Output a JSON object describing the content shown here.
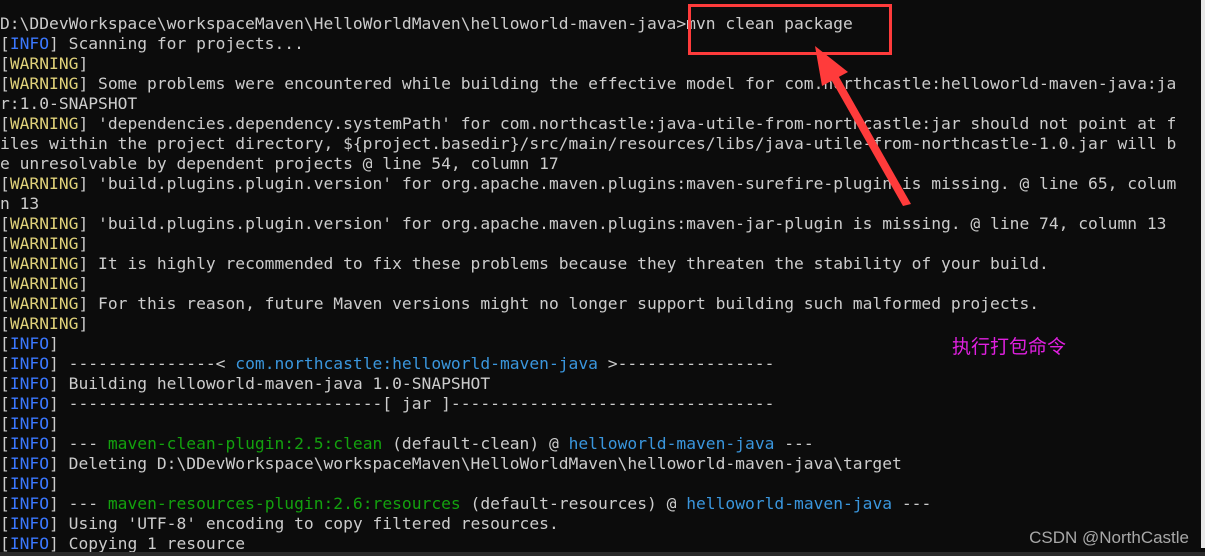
{
  "colors": {
    "default": "#cccccc",
    "info": "#3b78ff",
    "warning": "#e0d27a",
    "plugin": "#13a10e",
    "project": "#3a96dd",
    "highlight": "#ff3b3b",
    "note": "#e020e0"
  },
  "lines": [
    [
      {
        "t": "D:\\DDevWorkspace\\workspaceMaven\\HelloWorldMaven\\helloworld-maven-java>mvn clean package",
        "c": "d"
      }
    ],
    [
      {
        "t": "[",
        "c": "d"
      },
      {
        "t": "INFO",
        "c": "i"
      },
      {
        "t": "] Scanning for projects...",
        "c": "d"
      }
    ],
    [
      {
        "t": "[",
        "c": "d"
      },
      {
        "t": "WARNING",
        "c": "w"
      },
      {
        "t": "]",
        "c": "d"
      }
    ],
    [
      {
        "t": "[",
        "c": "d"
      },
      {
        "t": "WARNING",
        "c": "w"
      },
      {
        "t": "] Some problems were encountered while building the effective model for com.northcastle:helloworld-maven-java:ja",
        "c": "d"
      }
    ],
    [
      {
        "t": "r:1.0-SNAPSHOT",
        "c": "d"
      }
    ],
    [
      {
        "t": "[",
        "c": "d"
      },
      {
        "t": "WARNING",
        "c": "w"
      },
      {
        "t": "] 'dependencies.dependency.systemPath' for com.northcastle:java-utile-from-northcastle:jar should not point at f",
        "c": "d"
      }
    ],
    [
      {
        "t": "iles within the project directory, ${project.basedir}/src/main/resources/libs/java-utile-from-northcastle-1.0.jar will b",
        "c": "d"
      }
    ],
    [
      {
        "t": "e unresolvable by dependent projects @ line 54, column 17",
        "c": "d"
      }
    ],
    [
      {
        "t": "[",
        "c": "d"
      },
      {
        "t": "WARNING",
        "c": "w"
      },
      {
        "t": "] 'build.plugins.plugin.version' for org.apache.maven.plugins:maven-surefire-plugin is missing. @ line 65, colum",
        "c": "d"
      }
    ],
    [
      {
        "t": "n 13",
        "c": "d"
      }
    ],
    [
      {
        "t": "[",
        "c": "d"
      },
      {
        "t": "WARNING",
        "c": "w"
      },
      {
        "t": "] 'build.plugins.plugin.version' for org.apache.maven.plugins:maven-jar-plugin is missing. @ line 74, column 13",
        "c": "d"
      }
    ],
    [
      {
        "t": "[",
        "c": "d"
      },
      {
        "t": "WARNING",
        "c": "w"
      },
      {
        "t": "]",
        "c": "d"
      }
    ],
    [
      {
        "t": "[",
        "c": "d"
      },
      {
        "t": "WARNING",
        "c": "w"
      },
      {
        "t": "] It is highly recommended to fix these problems because they threaten the stability of your build.",
        "c": "d"
      }
    ],
    [
      {
        "t": "[",
        "c": "d"
      },
      {
        "t": "WARNING",
        "c": "w"
      },
      {
        "t": "]",
        "c": "d"
      }
    ],
    [
      {
        "t": "[",
        "c": "d"
      },
      {
        "t": "WARNING",
        "c": "w"
      },
      {
        "t": "] For this reason, future Maven versions might no longer support building such malformed projects.",
        "c": "d"
      }
    ],
    [
      {
        "t": "[",
        "c": "d"
      },
      {
        "t": "WARNING",
        "c": "w"
      },
      {
        "t": "]",
        "c": "d"
      }
    ],
    [
      {
        "t": "[",
        "c": "d"
      },
      {
        "t": "INFO",
        "c": "i"
      },
      {
        "t": "]",
        "c": "d"
      }
    ],
    [
      {
        "t": "[",
        "c": "d"
      },
      {
        "t": "INFO",
        "c": "i"
      },
      {
        "t": "] ---------------< ",
        "c": "d"
      },
      {
        "t": "com.northcastle:helloworld-maven-java",
        "c": "b"
      },
      {
        "t": " >----------------",
        "c": "d"
      }
    ],
    [
      {
        "t": "[",
        "c": "d"
      },
      {
        "t": "INFO",
        "c": "i"
      },
      {
        "t": "] Building helloworld-maven-java 1.0-SNAPSHOT",
        "c": "d"
      }
    ],
    [
      {
        "t": "[",
        "c": "d"
      },
      {
        "t": "INFO",
        "c": "i"
      },
      {
        "t": "] --------------------------------[ jar ]---------------------------------",
        "c": "d"
      }
    ],
    [
      {
        "t": "[",
        "c": "d"
      },
      {
        "t": "INFO",
        "c": "i"
      },
      {
        "t": "]",
        "c": "d"
      }
    ],
    [
      {
        "t": "[",
        "c": "d"
      },
      {
        "t": "INFO",
        "c": "i"
      },
      {
        "t": "] --- ",
        "c": "d"
      },
      {
        "t": "maven-clean-plugin:2.5:clean",
        "c": "g"
      },
      {
        "t": " (default-clean) @ ",
        "c": "d"
      },
      {
        "t": "helloworld-maven-java",
        "c": "b"
      },
      {
        "t": " ---",
        "c": "d"
      }
    ],
    [
      {
        "t": "[",
        "c": "d"
      },
      {
        "t": "INFO",
        "c": "i"
      },
      {
        "t": "] Deleting D:\\DDevWorkspace\\workspaceMaven\\HelloWorldMaven\\helloworld-maven-java\\target",
        "c": "d"
      }
    ],
    [
      {
        "t": "[",
        "c": "d"
      },
      {
        "t": "INFO",
        "c": "i"
      },
      {
        "t": "]",
        "c": "d"
      }
    ],
    [
      {
        "t": "[",
        "c": "d"
      },
      {
        "t": "INFO",
        "c": "i"
      },
      {
        "t": "] --- ",
        "c": "d"
      },
      {
        "t": "maven-resources-plugin:2.6:resources",
        "c": "g"
      },
      {
        "t": " (default-resources) @ ",
        "c": "d"
      },
      {
        "t": "helloworld-maven-java",
        "c": "b"
      },
      {
        "t": " ---",
        "c": "d"
      }
    ],
    [
      {
        "t": "[",
        "c": "d"
      },
      {
        "t": "INFO",
        "c": "i"
      },
      {
        "t": "] Using 'UTF-8' encoding to copy filtered resources.",
        "c": "d"
      }
    ],
    [
      {
        "t": "[",
        "c": "d"
      },
      {
        "t": "INFO",
        "c": "i"
      },
      {
        "t": "] Copying 1 resource",
        "c": "d"
      }
    ]
  ],
  "annotation": {
    "note": "执行打包命令",
    "arrow_icon": "red-arrow"
  },
  "watermark": "CSDN @NorthCastle"
}
